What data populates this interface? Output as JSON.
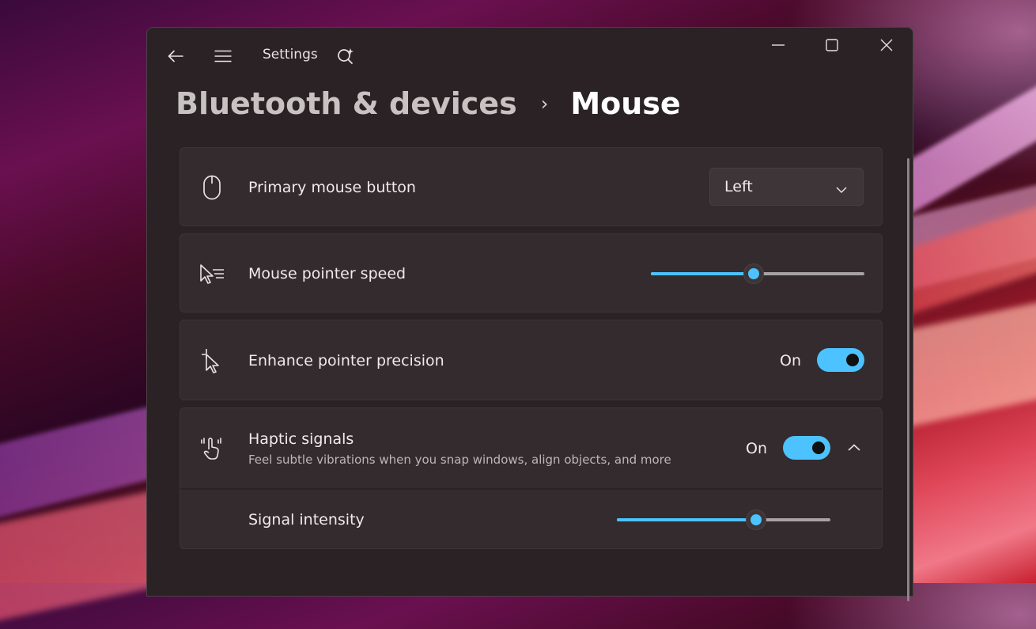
{
  "window": {
    "title": "Settings"
  },
  "breadcrumb": {
    "parent": "Bluetooth & devices",
    "separator": "›",
    "current": "Mouse"
  },
  "rows": {
    "primary_button": {
      "label": "Primary mouse button",
      "value": "Left"
    },
    "pointer_speed": {
      "label": "Mouse pointer speed",
      "level": 0.48
    },
    "precision": {
      "label": "Enhance pointer precision",
      "state": "On",
      "enabled": true
    },
    "haptic": {
      "label": "Haptic signals",
      "description": "Feel subtle vibrations when you snap windows, align objects, and more",
      "state": "On",
      "enabled": true,
      "expanded": true
    },
    "signal_intensity": {
      "label": "Signal intensity",
      "level": 0.65
    }
  },
  "icons": {
    "back": "back-arrow-icon",
    "menu": "hamburger-menu-icon",
    "search": "search-sparkle-icon",
    "minimize": "minimize-icon",
    "maximize": "maximize-icon",
    "close": "close-icon",
    "mouse": "mouse-icon",
    "speed": "pointer-speed-icon",
    "precision": "pointer-precision-icon",
    "haptic": "haptic-hand-icon"
  },
  "colors": {
    "accent": "#4cc2ff",
    "window_bg": "#2a2224",
    "card_bg": "#332b2d"
  }
}
